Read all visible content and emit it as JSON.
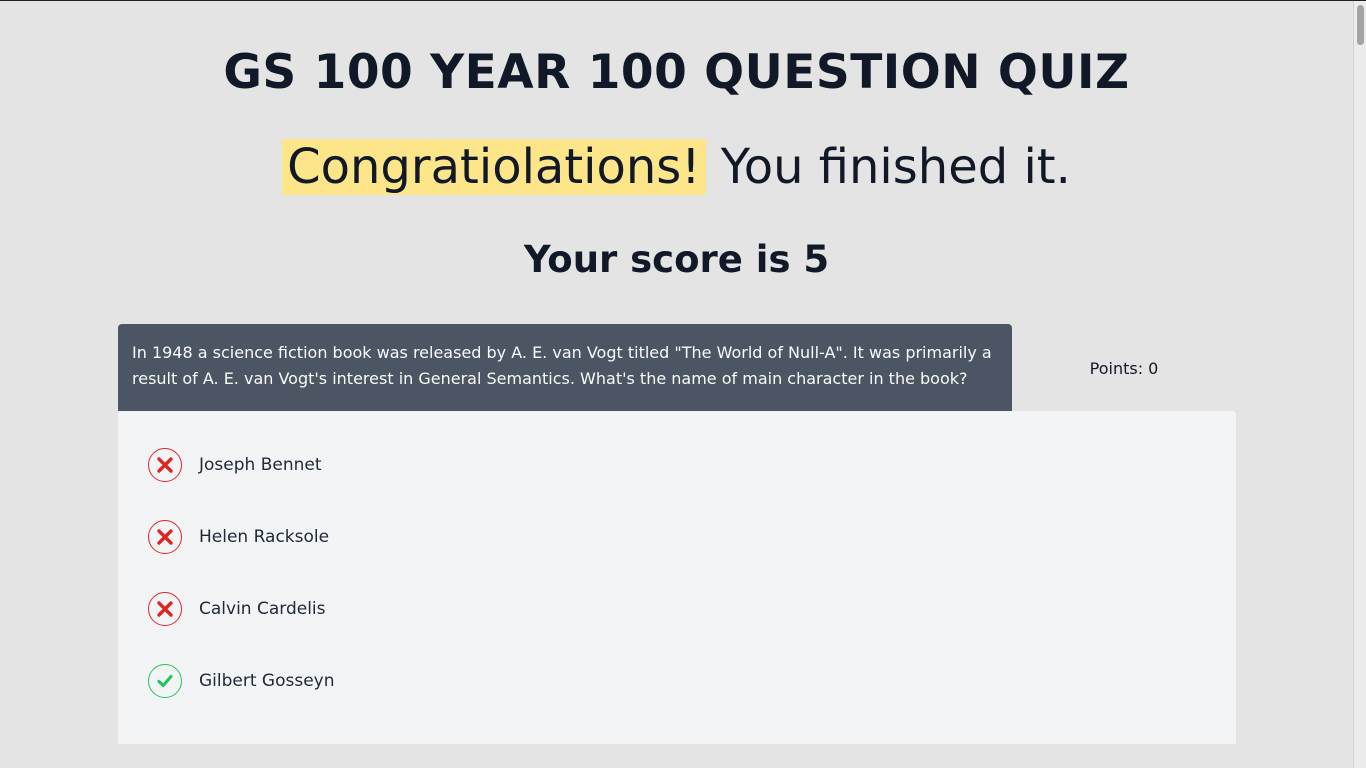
{
  "quiz": {
    "title": "GS 100 YEAR 100 QUESTION QUIZ"
  },
  "result": {
    "congrats_highlight": "Congratiolations!",
    "congrats_rest": "You finished it.",
    "score_prefix": "Your score is",
    "score_value": "5"
  },
  "question": {
    "text": "In 1948 a science fiction book was released by A. E. van Vogt titled \"The World of Null-A\". It was primarily a result of A. E. van Vogt's interest in General Semantics. What's the name of main character in the book?",
    "points_label": "Points: 0"
  },
  "answers": [
    {
      "label": "Joseph Bennet",
      "status": "wrong",
      "icon": "x-mark-icon"
    },
    {
      "label": "Helen Racksole",
      "status": "wrong",
      "icon": "x-mark-icon"
    },
    {
      "label": "Calvin Cardelis",
      "status": "wrong",
      "icon": "x-mark-icon"
    },
    {
      "label": "Gilbert Gosseyn",
      "status": "correct",
      "icon": "check-mark-icon"
    }
  ],
  "colors": {
    "highlight": "#fde68a",
    "question_bg": "#4b5563",
    "wrong": "#dc2626",
    "correct": "#22c55e"
  }
}
